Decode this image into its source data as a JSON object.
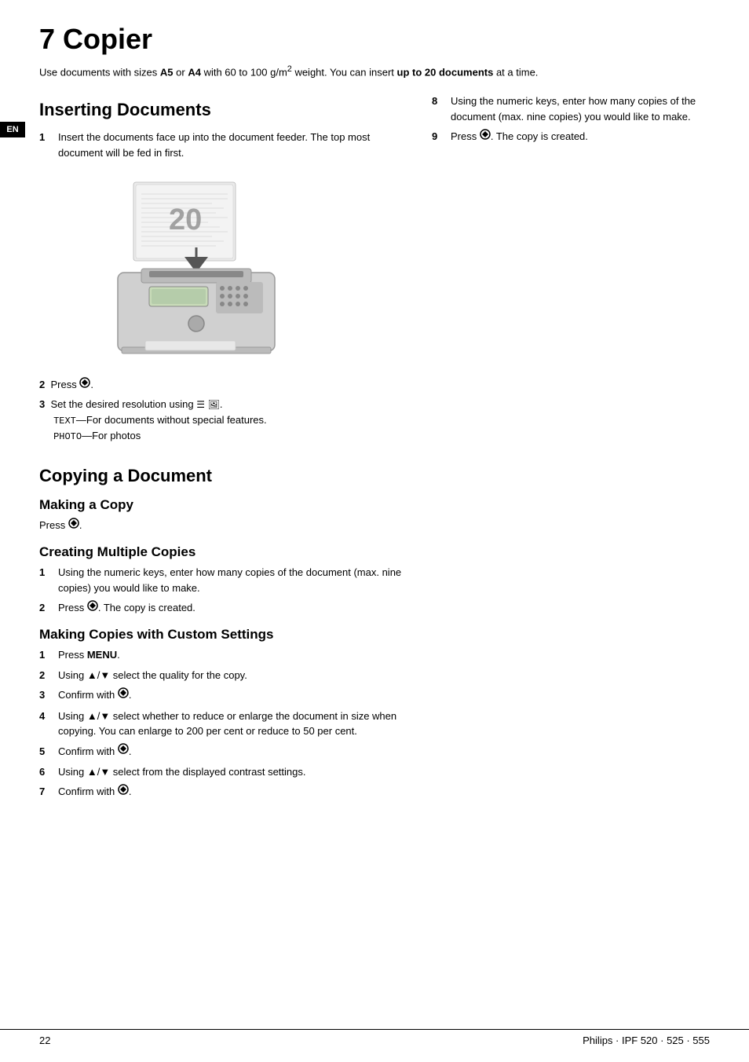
{
  "page": {
    "chapter_number": "7",
    "chapter_title": "Copier",
    "en_label": "EN",
    "intro": {
      "text": "Use documents with sizes ",
      "bold1": "A5",
      "text2": " or ",
      "bold2": "A4",
      "text3": " with 60 to 100 g/m² weight. You can insert ",
      "bold3": "up to 20 documents",
      "text4": " at a time."
    },
    "inserting_documents": {
      "title": "Inserting Documents",
      "steps": [
        {
          "num": "1",
          "text": "Insert the documents face up into the document feeder. The top most document will be fed in first."
        }
      ],
      "step2": {
        "num": "2",
        "text": "Press"
      },
      "step3": {
        "num": "3",
        "text1": "Set the desired resolution using",
        "text2": "TEXT",
        "text3": "—For documents without special features.",
        "text4": "PHOTO",
        "text5": "—For photos"
      }
    },
    "copying_a_document": {
      "title": "Copying a Document",
      "making_a_copy": {
        "title": "Making a Copy",
        "text": "Press"
      },
      "creating_multiple": {
        "title": "Creating Multiple Copies",
        "steps": [
          {
            "num": "1",
            "text": "Using the numeric keys, enter how many copies of the document (max. nine copies) you would like to make."
          },
          {
            "num": "2",
            "text": "Press",
            "text2": ". The copy is created."
          }
        ]
      },
      "custom_settings": {
        "title": "Making Copies with Custom Settings",
        "steps": [
          {
            "num": "1",
            "text": "Press",
            "bold": "MENU",
            "text_after": "."
          },
          {
            "num": "2",
            "text": "Using ▲/▼ select the quality for the copy."
          },
          {
            "num": "3",
            "text": "Confirm with"
          },
          {
            "num": "4",
            "text": "Using ▲/▼ select whether to reduce or enlarge the document in size when copying. You can enlarge to 200 per cent or reduce to 50 per cent."
          },
          {
            "num": "5",
            "text": "Confirm with"
          },
          {
            "num": "6",
            "text": "Using ▲/▼ select from the displayed contrast settings."
          },
          {
            "num": "7",
            "text": "Confirm with"
          }
        ]
      }
    },
    "right_column": {
      "step8": {
        "num": "8",
        "text": "Using the numeric keys, enter how many copies of the document (max. nine copies) you would like to make."
      },
      "step9": {
        "num": "9",
        "text": "Press",
        "text2": ". The copy is created."
      }
    },
    "bottom": {
      "page_number": "22",
      "brand": "Philips · IPF 520 · 525 · 555"
    }
  }
}
